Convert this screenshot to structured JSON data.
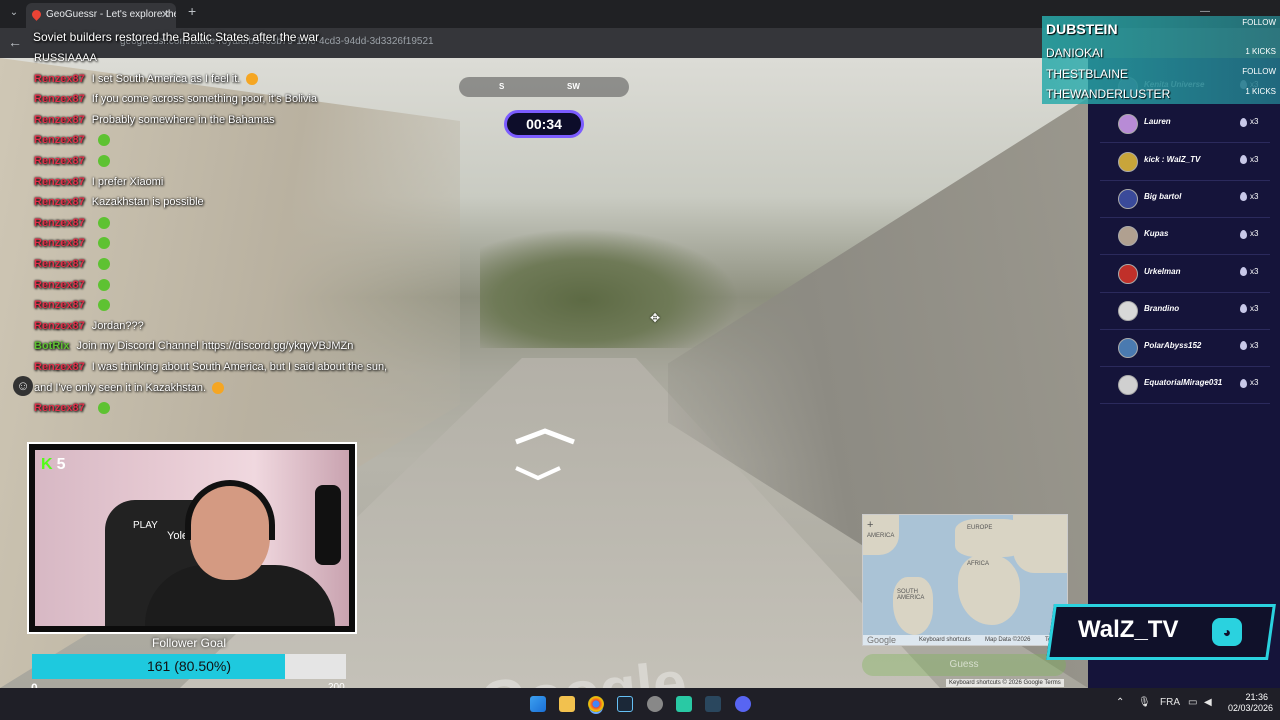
{
  "browser": {
    "tab_title": "GeoGuessr - Let's explore the w",
    "url": "geoguessr.com/battle-royale/b3463b79-15f6-4cd3-94dd-3d3326f19521"
  },
  "streetview": {
    "compass_s": "S",
    "compass_sw": "SW",
    "timer": "00:34",
    "footer_shortcuts": "Keyboard shortcuts",
    "footer_copyright": "© 2026 Google",
    "footer_terms": "Terms"
  },
  "chat": {
    "top_message": "Soviet builders restored the Baltic States after the war",
    "lines": [
      {
        "user": "",
        "msg": "RUSSIAAAA"
      },
      {
        "user": "Renzex87",
        "msg": "I set South America as I feel it.",
        "emote": "laugh"
      },
      {
        "user": "Renzex87",
        "msg": "If you come across something poor, it's Bolivia"
      },
      {
        "user": "Renzex87",
        "msg": "Probably somewhere in the Bahamas"
      },
      {
        "user": "Renzex87",
        "msg": "",
        "emote": "green"
      },
      {
        "user": "Renzex87",
        "msg": "",
        "emote": "green"
      },
      {
        "user": "Renzex87",
        "msg": "I prefer Xiaomi"
      },
      {
        "user": "Renzex87",
        "msg": "Kazakhstan is possible"
      },
      {
        "user": "Renzex87",
        "msg": "",
        "emote": "green"
      },
      {
        "user": "Renzex87",
        "msg": "",
        "emote": "green"
      },
      {
        "user": "Renzex87",
        "msg": "",
        "emote": "green"
      },
      {
        "user": "Renzex87",
        "msg": "",
        "emote": "green"
      },
      {
        "user": "Renzex87",
        "msg": "",
        "emote": "green"
      },
      {
        "user": "Renzex87",
        "msg": "Jordan???"
      },
      {
        "user": "BotRix",
        "msg": "Join my Discord Channel https://discord.gg/ykqyVBJMZn",
        "user_color": "#5ec232"
      },
      {
        "user": "Renzex87",
        "msg": "I was thinking about South America, but I said about the sun,"
      },
      {
        "user": "",
        "msg": "and I've only seen it in Kazakhstan.",
        "emote": "laugh"
      },
      {
        "user": "Renzex87",
        "msg": "",
        "emote": "green"
      }
    ]
  },
  "webcam": {
    "kick_count": "5",
    "chair_brand": "Yole",
    "chair_tag": "PLAY"
  },
  "follower_goal": {
    "label": "Follower Goal",
    "progress_text": "161 (80.50%)",
    "current": 161,
    "target": 200,
    "percent": 80.5,
    "min_label": "0",
    "max_label": "200"
  },
  "minimap": {
    "zoom_in": "+",
    "label_europe": "EUROPE",
    "label_africa": "AFRICA",
    "label_south_america": "SOUTH AMERICA",
    "label_america": "AMERICA",
    "footer_google": "Google",
    "footer_shortcuts": "Keyboard shortcuts",
    "footer_mapdata": "Map Data ©2026",
    "footer_terms": "Ter",
    "guess_label": "Guess"
  },
  "followers_overlay": {
    "names": [
      "DUBSTEIN",
      "DANIOKAI",
      "THESTBLAINE",
      "THEWANDERLUSTER"
    ],
    "tag_follow": "FOLLOW",
    "tag_kicks": "1 KICKS"
  },
  "players": [
    {
      "name": "Kenita Universe",
      "lives": "x3",
      "avatar_color": "#7a6aa8"
    },
    {
      "name": "Lauren",
      "lives": "x3",
      "avatar_color": "#b88bd6"
    },
    {
      "name": "kick : WalZ_TV",
      "lives": "x3",
      "avatar_color": "#c8a53a"
    },
    {
      "name": "Big bartol",
      "lives": "x3",
      "avatar_color": "#3a4a9a"
    },
    {
      "name": "Kupas",
      "lives": "x3",
      "avatar_color": "#b0a090"
    },
    {
      "name": "Urkelman",
      "lives": "x3",
      "avatar_color": "#c0302a"
    },
    {
      "name": "Brandino",
      "lives": "x3",
      "avatar_color": "#d8d8d8"
    },
    {
      "name": "PolarAbyss152",
      "lives": "x3",
      "avatar_color": "#4a7ab0"
    },
    {
      "name": "EquatorialMirage031",
      "lives": "x3",
      "avatar_color": "#d0d0d0"
    }
  ],
  "brand": {
    "logo_text": "WalZ_TV",
    "accent": "#2ad2df"
  },
  "taskbar": {
    "language": "FRA",
    "time": "21:36",
    "date": "02/03/2026"
  }
}
